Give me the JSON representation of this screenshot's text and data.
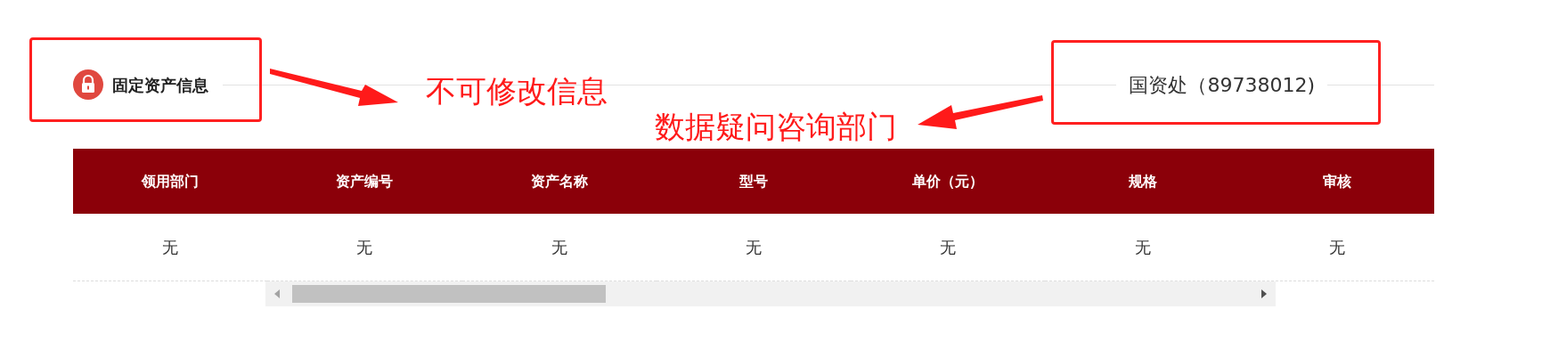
{
  "section": {
    "title": "固定资产信息",
    "locked": true,
    "contact": "国资处（89738012)"
  },
  "table": {
    "columns": [
      "领用部门",
      "资产编号",
      "资产名称",
      "型号",
      "单价（元）",
      "规格",
      "审核"
    ],
    "rows": [
      [
        "无",
        "无",
        "无",
        "无",
        "无",
        "无",
        "无"
      ]
    ]
  },
  "annotations": [
    {
      "kind": "box"
    },
    {
      "kind": "box"
    },
    {
      "kind": "note",
      "text": "不可修改信息"
    },
    {
      "kind": "note",
      "text": "数据疑问咨询部门"
    }
  ]
}
